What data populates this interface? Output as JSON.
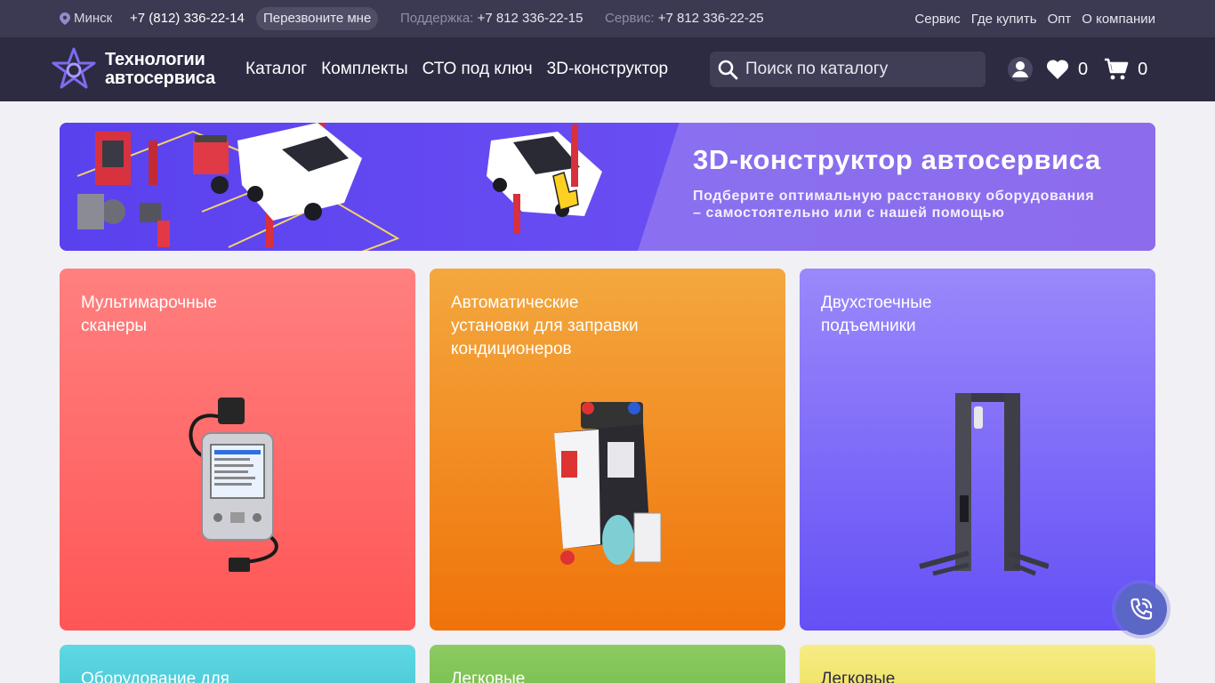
{
  "topbar": {
    "city": "Минск",
    "phone_main": "+7 (812) 336-22-14",
    "callback_label": "Перезвоните мне",
    "support_label": "Поддержка:",
    "support_phone": "+7 812 336-22-15",
    "service_label": "Сервис:",
    "service_phone": "+7 812 336-22-25",
    "links": [
      "Сервис",
      "Где купить",
      "Опт",
      "О компании"
    ]
  },
  "header": {
    "logo_line1": "Технологии",
    "logo_line2": "автосервиса",
    "nav": [
      "Каталог",
      "Комплекты",
      "СТО под ключ",
      "3D-конструктор"
    ],
    "search_placeholder": "Поиск по каталогу",
    "favorites_count": "0",
    "cart_count": "0"
  },
  "banner": {
    "title": "3D-конструктор автосервиса",
    "subtitle_line1": "Подберите оптимальную расстановку оборудования",
    "subtitle_line2": "– самостоятельно или с нашей помощью"
  },
  "cards": [
    {
      "title_line1": "Мультимарочные",
      "title_line2": "сканеры",
      "title_line3": "",
      "image": "scanner-device-icon"
    },
    {
      "title_line1": "Автоматические",
      "title_line2": "установки для заправки",
      "title_line3": "кондиционеров",
      "image": "ac-station-icon"
    },
    {
      "title_line1": "Двухстоечные",
      "title_line2": "подъемники",
      "title_line3": "",
      "image": "two-post-lift-icon"
    },
    {
      "title_line1": "Оборудование для",
      "title_line2": "",
      "title_line3": ""
    },
    {
      "title_line1": "Легковые",
      "title_line2": "",
      "title_line3": ""
    },
    {
      "title_line1": "Легковые",
      "title_line2": "",
      "title_line3": ""
    }
  ],
  "colors": {
    "topbar": "#3c3a52",
    "header": "#2d2b42",
    "page_bg": "#f1f0f4",
    "card_red": "#ff5656",
    "card_orange": "#f0730a",
    "card_purple": "#6450f5",
    "card_teal": "#4bc8d6",
    "card_green": "#78bf4d",
    "card_yellow": "#efe165",
    "fab": "#5b67c6"
  }
}
